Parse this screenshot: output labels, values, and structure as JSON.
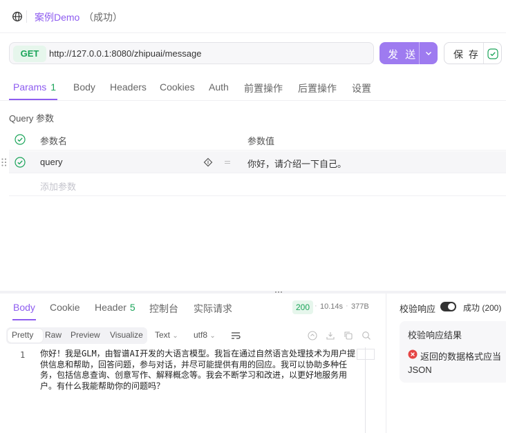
{
  "header": {
    "case_name": "案例Demo",
    "case_status": "（成功）"
  },
  "request": {
    "method": "GET",
    "url": "http://127.0.0.1:8080/zhipuai/message",
    "send_label": "发 送",
    "save_label": "保 存",
    "method_color": "#1aa459",
    "accent_color": "#8e5cf0"
  },
  "req_tabs": {
    "params": "Params",
    "params_count": "1",
    "body": "Body",
    "headers": "Headers",
    "cookies": "Cookies",
    "auth": "Auth",
    "pre_ops": "前置操作",
    "post_ops": "后置操作",
    "settings": "设置"
  },
  "query": {
    "section_title": "Query 参数",
    "col_name": "参数名",
    "col_value": "参数值",
    "rows": [
      {
        "name": "query",
        "value": "你好，请介绍一下自己。",
        "enabled": true
      }
    ],
    "add_placeholder": "添加参数"
  },
  "response": {
    "tabs": {
      "body": "Body",
      "cookie": "Cookie",
      "header": "Header",
      "header_count": "5",
      "console": "控制台",
      "actual_request": "实际请求"
    },
    "status_code": "200",
    "time": "10.14s",
    "size": "377B",
    "formats": {
      "pretty": "Pretty",
      "raw": "Raw",
      "preview": "Preview",
      "visualize": "Visualize"
    },
    "view_type": "Text",
    "encoding": "utf8",
    "line_number": "1",
    "body_text": "你好！我是GLM，由智谱AI开发的大语言模型。我旨在通过自然语言处理技术为用户提供信息和帮助，回答问题，参与对话，并尽可能提供有用的回应。我可以协助多种任务，包括信息查询、创意写作、解释概念等。我会不断学习和改进，以更好地服务用户。有什么我能帮助你的问题吗？"
  },
  "validation": {
    "label": "校验响应",
    "toggle_on": true,
    "success": "成功 (200)",
    "result_title": "校验响应结果",
    "message": "返回的数据格式应当",
    "message_tail": "JSON"
  }
}
